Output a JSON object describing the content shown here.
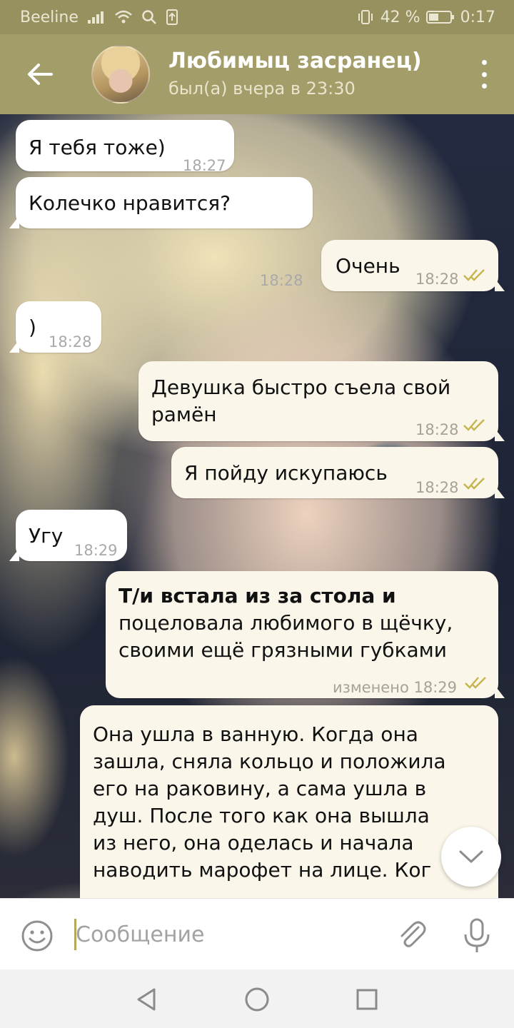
{
  "status_bar": {
    "carrier": "Beeline",
    "battery_percent": "42 %",
    "time": "0:17"
  },
  "header": {
    "contact_name": "Любимыц засранец)",
    "last_seen": "был(а) вчера в 23:30"
  },
  "messages": [
    {
      "direction": "in",
      "text": "Я тебя тоже)",
      "time": "18:27"
    },
    {
      "direction": "in",
      "text": "Колечко нравится?",
      "time": "18:28"
    },
    {
      "direction": "out",
      "text": "Очень",
      "time": "18:28",
      "read": true
    },
    {
      "direction": "in",
      "text": ")",
      "time": "18:28"
    },
    {
      "direction": "out",
      "lines": [
        "Девушка быстро съела свой",
        "рамён"
      ],
      "time": "18:28",
      "read": true
    },
    {
      "direction": "out",
      "text": "Я пойду искупаюсь",
      "time": "18:28",
      "read": true
    },
    {
      "direction": "in",
      "text": "Угу",
      "time": "18:29"
    },
    {
      "direction": "out",
      "lines": [
        "Т/и встала из за стола и",
        "поцеловала любимого в щёчку,",
        "своими ещё грязными губками"
      ],
      "time": "изменено 18:29",
      "read": true
    },
    {
      "direction": "out",
      "lines": [
        "Она ушла в ванную. Когда она",
        "зашла, сняла кольцо и положила",
        "его на раковину, а сама ушла в",
        "душ. После того как она вышла",
        "из него, она оделась и начала",
        "наводить марофет на лице. Ког"
      ]
    }
  ],
  "input": {
    "placeholder": "Сообщение"
  },
  "colors": {
    "header": "#a39d6a",
    "status_bar": "#97915f",
    "outgoing_bubble": "#faf6e9",
    "incoming_bubble": "#ffffff",
    "check_marks": "#c4b54e",
    "accent": "#b5a957"
  },
  "icons": {
    "back": "arrow-left-icon",
    "menu": "more-vertical-icon",
    "emoji": "smile-icon",
    "attach": "paperclip-icon",
    "mic": "microphone-icon",
    "scroll_down": "chevron-down-icon",
    "read_status": "double-check-icon"
  }
}
